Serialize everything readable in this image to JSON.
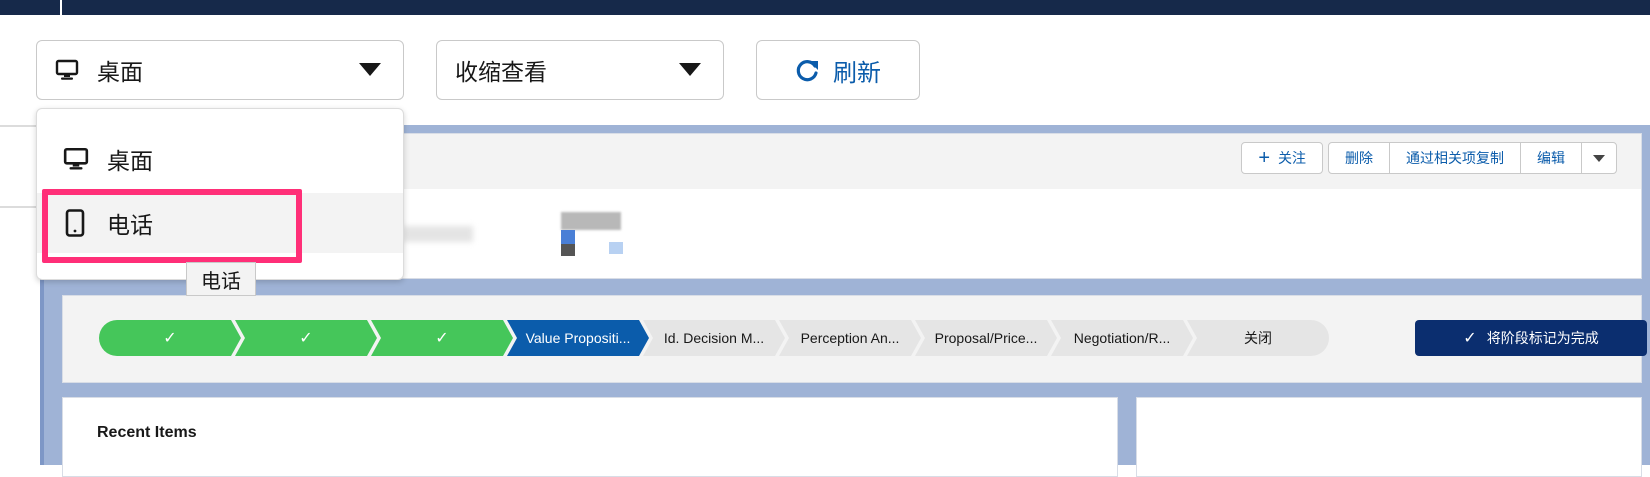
{
  "toolbar": {
    "device_select": {
      "value": "桌面",
      "icon": "monitor-icon"
    },
    "view_select": {
      "value": "收缩查看"
    },
    "refresh_label": "刷新"
  },
  "dropdown": {
    "options": [
      {
        "label": "桌面",
        "icon": "monitor-icon"
      },
      {
        "label": "电话",
        "icon": "phone-icon"
      }
    ],
    "hovered": "电话",
    "tooltip": "电话"
  },
  "record": {
    "actions": [
      "关注",
      "删除",
      "通过相关项复制",
      "编辑"
    ],
    "follow_prefix": "+"
  },
  "path": {
    "steps": [
      {
        "label": "✓",
        "state": "done"
      },
      {
        "label": "✓",
        "state": "done"
      },
      {
        "label": "✓",
        "state": "done"
      },
      {
        "label": "Value Propositi...",
        "state": "current"
      },
      {
        "label": "Id. Decision M...",
        "state": "todo"
      },
      {
        "label": "Perception An...",
        "state": "todo"
      },
      {
        "label": "Proposal/Price...",
        "state": "todo"
      },
      {
        "label": "Negotiation/R...",
        "state": "todo"
      },
      {
        "label": "关闭",
        "state": "todo"
      }
    ],
    "mark_complete": "将阶段标记为完成"
  },
  "recent": {
    "title": "Recent Items"
  },
  "colors": {
    "topbar": "#16294a",
    "brand_blue": "#0b5cab",
    "path_done": "#45c65a",
    "highlight": "#ff2f78"
  }
}
